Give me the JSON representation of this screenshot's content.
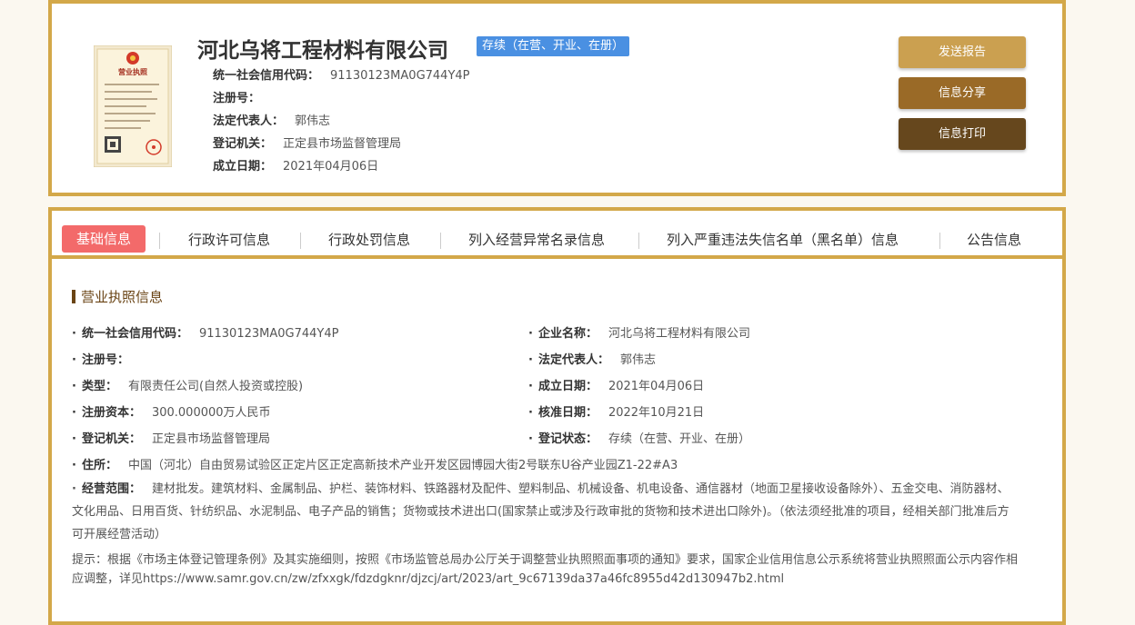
{
  "header": {
    "company_name": "河北乌将工程材料有限公司",
    "status_tag": "存续（在营、开业、在册）",
    "license_image_label": "营业执照",
    "rows": [
      {
        "label": "统一社会信用代码：",
        "value": "91130123MA0G744Y4P"
      },
      {
        "label": "注册号：",
        "value": ""
      },
      {
        "label": "法定代表人：",
        "value": "郭伟志"
      },
      {
        "label": "登记机关：",
        "value": "正定县市场监督管理局"
      },
      {
        "label": "成立日期：",
        "value": "2021年04月06日"
      }
    ],
    "buttons": {
      "report": "发送报告",
      "share": "信息分享",
      "print": "信息打印"
    }
  },
  "tabs": [
    {
      "label": "基础信息",
      "active": true
    },
    {
      "label": "行政许可信息",
      "active": false
    },
    {
      "label": "行政处罚信息",
      "active": false
    },
    {
      "label": "列入经营异常名录信息",
      "active": false
    },
    {
      "label": "列入严重违法失信名单（黑名单）信息",
      "active": false
    },
    {
      "label": "公告信息",
      "active": false
    }
  ],
  "section": {
    "title": "营业执照信息",
    "left": [
      {
        "label": "统一社会信用代码：",
        "value": "91130123MA0G744Y4P"
      },
      {
        "label": "注册号：",
        "value": ""
      },
      {
        "label": "类型：",
        "value": "有限责任公司(自然人投资或控股)"
      },
      {
        "label": "注册资本：",
        "value": "300.000000万人民币"
      },
      {
        "label": "登记机关：",
        "value": "正定县市场监督管理局"
      },
      {
        "label": "住所：",
        "value": "中国（河北）自由贸易试验区正定片区正定高新技术产业开发区园博园大街2号联东U谷产业园Z1-22#A3"
      }
    ],
    "right": [
      {
        "label": "企业名称：",
        "value": "河北乌将工程材料有限公司"
      },
      {
        "label": "法定代表人：",
        "value": "郭伟志"
      },
      {
        "label": "成立日期：",
        "value": "2021年04月06日"
      },
      {
        "label": "核准日期：",
        "value": "2022年10月21日"
      },
      {
        "label": "登记状态：",
        "value": "存续（在营、开业、在册）"
      }
    ],
    "scope_label": "经营范围：",
    "scope_value": "建材批发。建筑材料、金属制品、护栏、装饰材料、铁路器材及配件、塑料制品、机械设备、机电设备、通信器材（地面卫星接收设备除外）、五金交电、消防器材、文化用品、日用百货、针纺织品、水泥制品、电子产品的销售；货物或技术进出口(国家禁止或涉及行政审批的货物和技术进出口除外)。（依法须经批准的项目，经相关部门批准后方可开展经营活动）",
    "notice": "提示：根据《市场主体登记管理条例》及其实施细则，按照《市场监管总局办公厅关于调整营业执照照面事项的通知》要求，国家企业信用信息公示系统将营业执照照面公示内容作相应调整，详见https://www.samr.gov.cn/zw/zfxxgk/fdzdgknr/djzcj/art/2023/art_9c67139da37a46fc8955d42d130947b2.html"
  },
  "colors": {
    "border": "#d3a849",
    "tag_blue": "#4a90e2",
    "tab_active": "#f36a6a",
    "btn_report": "#cba050",
    "btn_share": "#9a6a27",
    "btn_print": "#66471d",
    "section_title": "#6a4415"
  }
}
